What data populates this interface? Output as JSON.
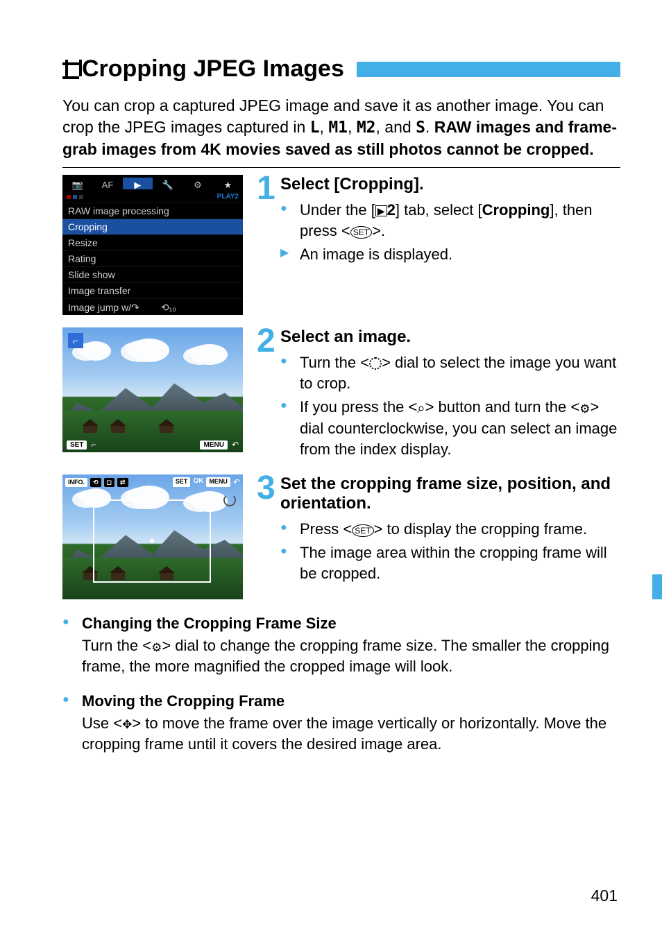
{
  "page_number": "401",
  "title": "Cropping JPEG Images",
  "intro": {
    "line1": "You can crop a captured JPEG image and save it as another image. You can crop the JPEG images captured in ",
    "sizes": {
      "l": "L",
      "m1": "M1",
      "m2": "M2",
      "s": "S"
    },
    "sep1": ", ",
    "sep2": ", ",
    "sep3": ", and ",
    "period": ". ",
    "bold_tail": "RAW images and frame-grab images from 4K movies saved as still photos cannot be cropped."
  },
  "menu_shot": {
    "tabs": [
      "📷",
      "AF",
      "▶",
      "🔧",
      "⚙",
      "★"
    ],
    "badge": "PLAY2",
    "items": [
      "RAW image processing",
      "Cropping",
      "Resize",
      "Rating",
      "Slide show",
      "Image transfer",
      "Image jump w/"
    ]
  },
  "shot2": {
    "bottom_left": "SET",
    "bottom_left_icon": "⌐",
    "bottom_right": "MENU",
    "bottom_right_icon": "↶"
  },
  "shot3": {
    "top_left_info": "INFO.",
    "top_set": "SET",
    "top_ok": "OK",
    "top_menu": "MENU",
    "top_menu_icon": "↶"
  },
  "steps": [
    {
      "num": "1",
      "heading": "Select [Cropping].",
      "bullets": [
        {
          "pre": "Under the [",
          "play2": "2",
          "mid": "] tab, select [",
          "bold": "Cropping",
          "post": "], then press <",
          "icon": "set",
          "end": ">."
        },
        {
          "arrow": true,
          "text": "An image is displayed."
        }
      ]
    },
    {
      "num": "2",
      "heading": "Select an image.",
      "bullets": [
        {
          "pre": "Turn the <",
          "icon": "dial1",
          "post": "> dial to select the image you want to crop."
        },
        {
          "pre": "If you press the <",
          "icon": "mag",
          "mid": "> button and turn the <",
          "icon2": "dial2",
          "post": "> dial counterclockwise, you can select an image from the index display."
        }
      ]
    },
    {
      "num": "3",
      "heading": "Set the cropping frame size, position, and orientation.",
      "bullets": [
        {
          "pre": "Press <",
          "icon": "set",
          "post": "> to display the cropping frame."
        },
        {
          "text": "The image area within the cropping frame will be cropped."
        }
      ]
    }
  ],
  "subs": [
    {
      "head": "Changing the Cropping Frame Size",
      "body_pre": "Turn the <",
      "body_icon": "dial2",
      "body_post": "> dial to change the cropping frame size. The smaller the cropping frame, the more magnified the cropped image will look."
    },
    {
      "head": "Moving the Cropping Frame",
      "body_pre": "Use <",
      "body_icon": "joy",
      "body_post": "> to move the frame over the image vertically or horizontally. Move the cropping frame until it covers the desired image area."
    }
  ]
}
